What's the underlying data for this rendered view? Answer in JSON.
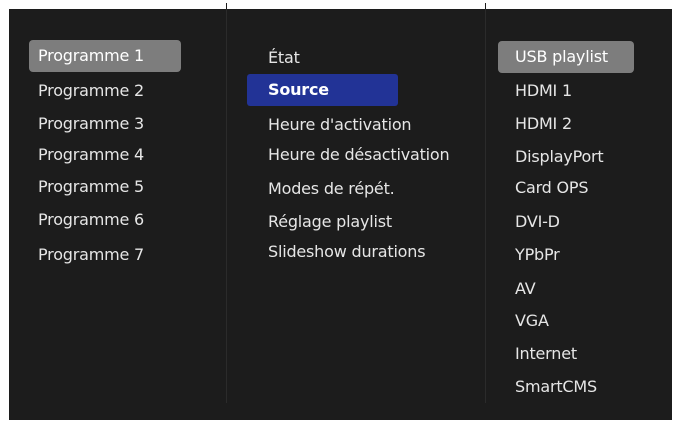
{
  "programmes": [
    "Programme 1",
    "Programme 2",
    "Programme 3",
    "Programme 4",
    "Programme 5",
    "Programme 6",
    "Programme 7"
  ],
  "settings": [
    "État",
    "Source",
    "Heure d'activation",
    "Heure de désactivation",
    "Modes de répét.",
    "Réglage playlist",
    "Slideshow durations"
  ],
  "sources": [
    "USB playlist",
    "HDMI 1",
    "HDMI 2",
    "DisplayPort",
    "Card OPS",
    "DVI-D",
    "YPbPr",
    "AV",
    "VGA",
    "Internet",
    "SmartCMS"
  ],
  "selected": {
    "programme": "Programme 1",
    "setting": "Source",
    "source": "USB playlist"
  },
  "colors": {
    "panel_background": "#1c1c1c",
    "selected_grey": "#7d7d7d",
    "selected_blue": "#223396",
    "text": "#e6e6e6"
  }
}
